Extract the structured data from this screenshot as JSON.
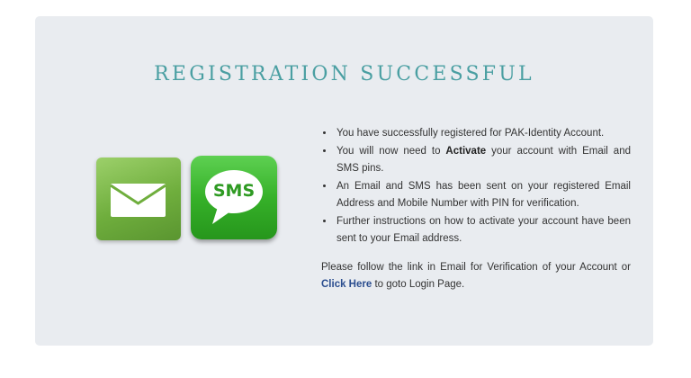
{
  "page": {
    "title": "REGISTRATION SUCCESSFUL"
  },
  "icons": {
    "email": "envelope-icon",
    "sms": "sms-speech-bubble-icon",
    "sms_label": "SMS"
  },
  "messages": {
    "items": [
      {
        "text": "You have successfully registered for PAK-Identity Account."
      },
      {
        "prefix": "You will now need to ",
        "bold": "Activate",
        "suffix": " your account with Email and SMS pins."
      },
      {
        "text": "An Email and SMS has been sent on your registered Email Address and Mobile Number with PIN for verification."
      },
      {
        "text": "Further instructions on how to activate your account have been sent to your Email address."
      }
    ],
    "note_prefix": "Please follow the link in Email for Verification of your Account or ",
    "link_label": "Click Here",
    "note_suffix": " to goto Login Page."
  },
  "colors": {
    "title": "#4a9fa2",
    "panel": "#e9ecf0",
    "link": "#2a4d8f",
    "email_icon": "#6fae3d",
    "sms_icon": "#36b129"
  }
}
